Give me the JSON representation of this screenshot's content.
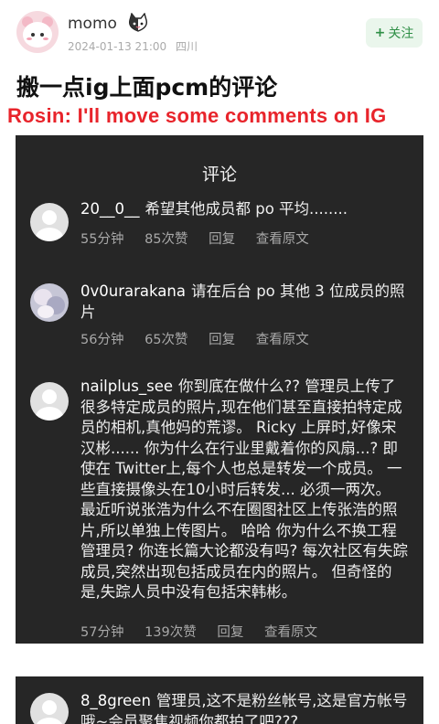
{
  "post": {
    "username": "momo",
    "date": "2024-01-13 21:00",
    "location": "四川",
    "follow_label": "关注",
    "title": "搬一点ig上面pcm的评论",
    "translation": "Rosin: I'll move some comments on IG"
  },
  "panel": {
    "title": "评论",
    "comments": [
      {
        "user": "20__0__",
        "text": "希望其他成员都 po 平均........",
        "time": "55分钟",
        "likes": "85次赞",
        "reply": "回复",
        "translate": "查看原文"
      },
      {
        "user": "0v0urarakana",
        "text": "请在后台 po 其他 3 位成员的照片",
        "time": "56分钟",
        "likes": "65次赞",
        "reply": "回复",
        "translate": "查看原文"
      },
      {
        "user": "nailplus_see",
        "text": "你到底在做什么?? 管理员上传了很多特定成员的照片,现在他们甚至直接拍特定成员的相机,真他妈的荒谬。 Ricky 上屏时,好像宋汉彬...... 你为什么在行业里戴着你的风扇...? 即使在 Twitter上,每个人也总是转发一个成员。 一些直接摄像头在10小时后转发... 必须一两次。 最近听说张浩为什么不在圈图社区上传张浩的照片,所以单独上传图片。 哈哈 你为什么不换工程管理员? 你连长篇大论都没有吗? 每次社区有失踪成员,突然出现包括成员在内的照片。 但奇怪的是,失踪人员中没有包括宋韩彬。",
        "time": "57分钟",
        "likes": "139次赞",
        "reply": "回复",
        "translate": "查看原文"
      }
    ]
  },
  "panel2": {
    "comment": {
      "user": "8_8green",
      "text": "管理员,这不是粉丝帐号,这是官方帐号哦~会员聚焦视频你都拍了吧???"
    }
  }
}
